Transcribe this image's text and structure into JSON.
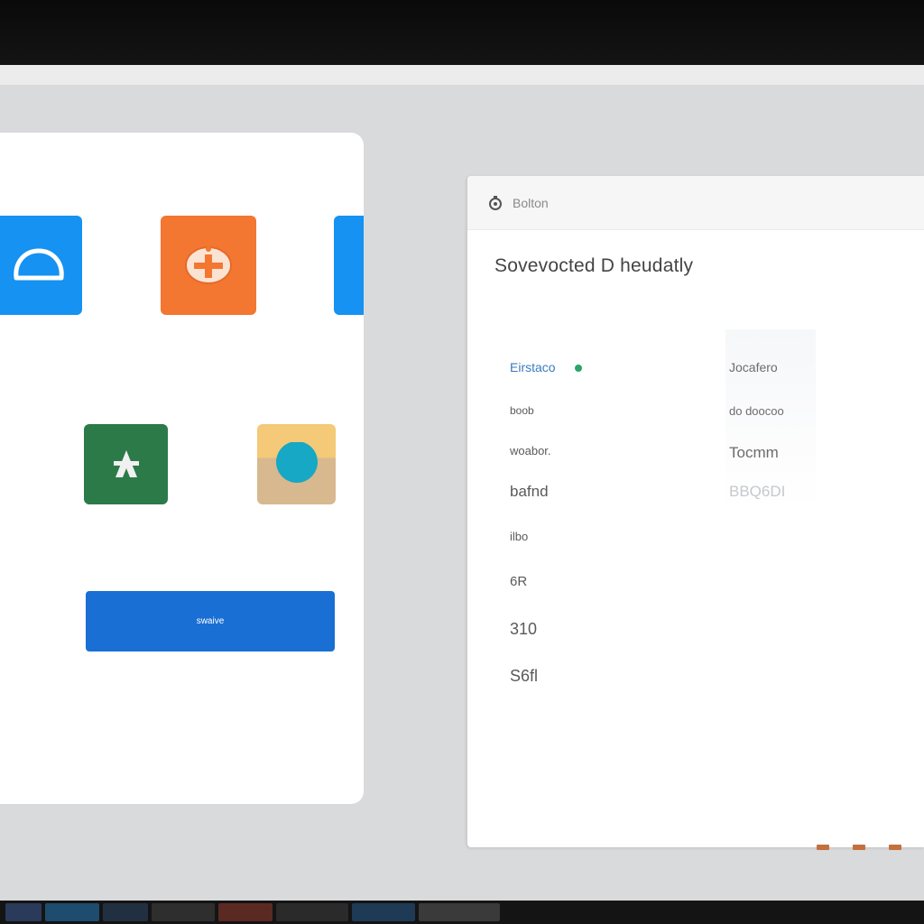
{
  "launcher": {
    "tiles": [
      {
        "icon": "cloud-icon",
        "color": "#1592f2"
      },
      {
        "icon": "gamepad-icon",
        "color": "#f37631"
      },
      {
        "icon": "app-icon",
        "color": "#1592f2"
      },
      {
        "icon": "tent-icon",
        "color": "#2b7a48"
      },
      {
        "icon": "photo-icon",
        "color": "#f4c977"
      }
    ],
    "button_label": "swaive"
  },
  "window": {
    "title": "Bolton",
    "heading": "Sovevocted D heudatly",
    "rows": [
      {
        "label": "Eirstaco",
        "value": "Jocafero",
        "status_color": "#2aa56a"
      },
      {
        "label": "boob",
        "value": "do doocoo"
      },
      {
        "label": "woabor.",
        "value": "Tocmm"
      },
      {
        "label": "bafnd",
        "value": "BBQ6DI"
      },
      {
        "label": "ilbo",
        "value": ""
      },
      {
        "label": "6R",
        "value": ""
      },
      {
        "label": "310",
        "value": ""
      },
      {
        "label": "S6fl",
        "value": ""
      }
    ]
  },
  "colors": {
    "accent_blue": "#1a6fd4",
    "screen_bg": "#d9dadc"
  }
}
